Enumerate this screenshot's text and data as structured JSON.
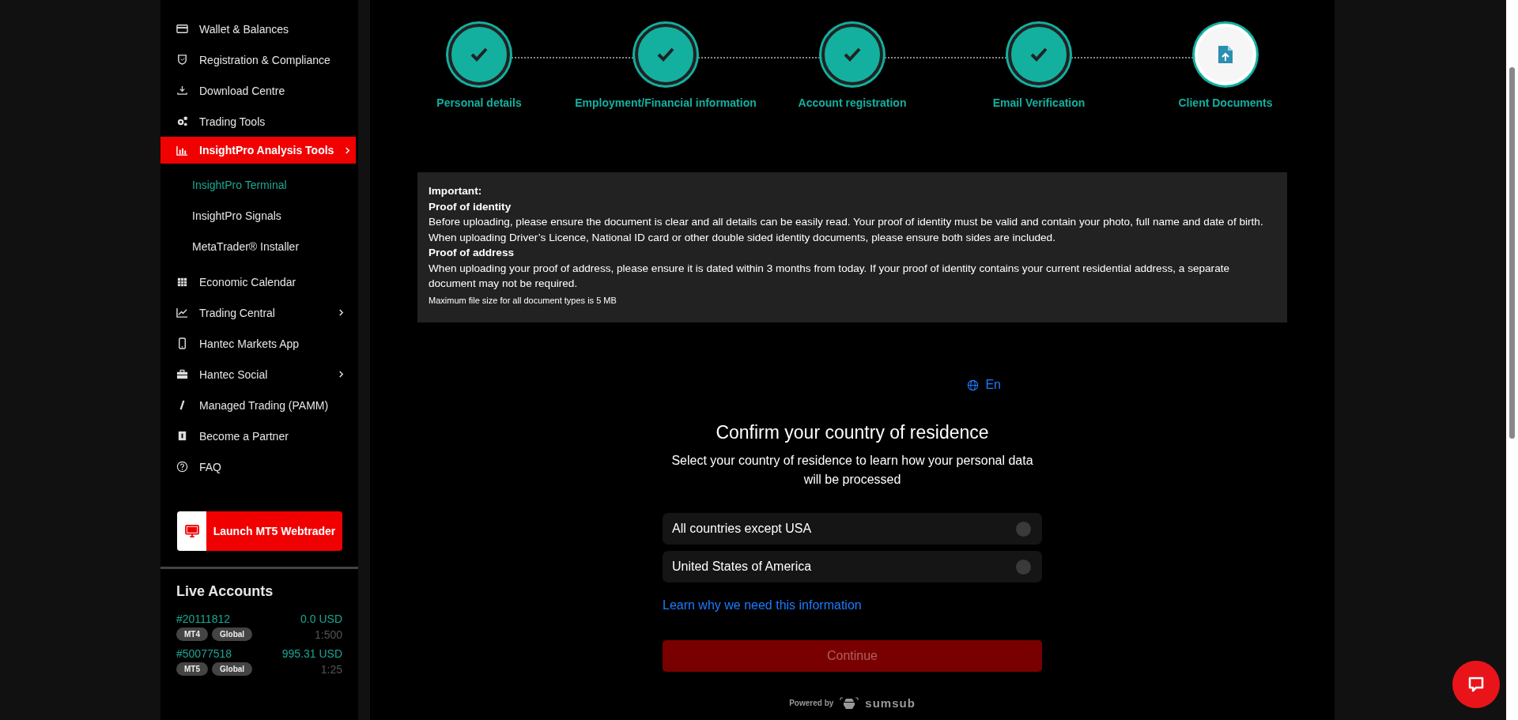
{
  "sidebar": {
    "items": [
      {
        "label": "Wallet & Balances",
        "expandable": false,
        "selected": false
      },
      {
        "label": "Registration & Compliance",
        "expandable": false,
        "selected": false
      },
      {
        "label": "Download Centre",
        "expandable": false,
        "selected": false
      },
      {
        "label": "Trading Tools",
        "expandable": false,
        "selected": false
      },
      {
        "label": "InsightPro Analysis Tools",
        "expandable": true,
        "selected": true,
        "children": [
          {
            "label": "InsightPro Terminal",
            "selected": true
          },
          {
            "label": "InsightPro Signals",
            "selected": false
          },
          {
            "label": "MetaTrader® Installer",
            "selected": false
          }
        ]
      },
      {
        "label": "Economic Calendar",
        "expandable": false,
        "selected": false
      },
      {
        "label": "Trading Central",
        "expandable": true,
        "selected": false
      },
      {
        "label": "Hantec Markets App",
        "expandable": false,
        "selected": false
      },
      {
        "label": "Hantec Social",
        "expandable": true,
        "selected": false
      },
      {
        "label": "Managed Trading (PAMM)",
        "expandable": false,
        "selected": false
      },
      {
        "label": "Become a Partner",
        "expandable": false,
        "selected": false
      },
      {
        "label": "FAQ",
        "expandable": false,
        "selected": false
      }
    ],
    "launch_button": "Launch MT5 Webtrader",
    "live_accounts": {
      "title": "Live Accounts",
      "accounts": [
        {
          "number": "#20111812",
          "balance": "0.0 USD",
          "leverage": "1:500",
          "tags": [
            "MT4",
            "Global"
          ]
        },
        {
          "number": "#50077518",
          "balance": "995.31 USD",
          "leverage": "1:25",
          "tags": [
            "MT5",
            "Global"
          ]
        }
      ]
    }
  },
  "steps": [
    {
      "label": "Personal details",
      "done": true
    },
    {
      "label": "Employment/Financial information",
      "done": true
    },
    {
      "label": "Account registration",
      "done": true
    },
    {
      "label": "Email Verification",
      "done": true
    },
    {
      "label": "Client Documents",
      "done": false
    }
  ],
  "notice": {
    "title": "Important:",
    "sections": [
      {
        "heading": "Proof of identity",
        "text": "Before uploading, please ensure the document is clear and all details can be easily read. Your proof of identity must be valid and contain your photo, full name and date of birth. When uploading Driver’s Licence, National ID card or other double sided identity documents, please ensure both sides are included."
      },
      {
        "heading": "Proof of address",
        "text": "When uploading your proof of address, please ensure it is dated within 3 months from today. If your proof of identity contains your current residential address, a separate document may not be required."
      }
    ],
    "footnote": "Maximum file size for all document types is 5 MB"
  },
  "verification": {
    "language": "En",
    "title": "Confirm your country of residence",
    "subtitle": "Select your country of residence to learn how your personal data will be processed",
    "options": [
      {
        "label": "All countries except USA",
        "selected": false
      },
      {
        "label": "United States of America",
        "selected": false
      }
    ],
    "link": "Learn why we need this information",
    "continue_button": {
      "label": "Continue",
      "disabled": true
    },
    "powered_by": "Powered by",
    "brand": "sumsub"
  }
}
